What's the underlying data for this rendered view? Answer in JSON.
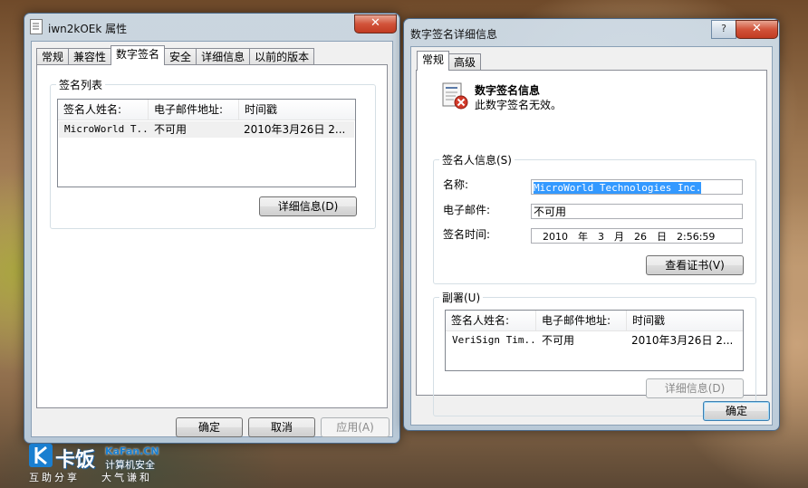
{
  "props_window": {
    "title": "iwn2kOEk 属性",
    "tabs": [
      "常规",
      "兼容性",
      "数字签名",
      "安全",
      "详细信息",
      "以前的版本"
    ],
    "active_tab": "数字签名",
    "group_label": "签名列表",
    "columns": [
      "签名人姓名:",
      "电子邮件地址:",
      "时间戳"
    ],
    "rows": [
      [
        "MicroWorld T...",
        "不可用",
        "2010年3月26日 2..."
      ]
    ],
    "details_button": "详细信息(D)",
    "ok_button": "确定",
    "cancel_button": "取消",
    "apply_button": "应用(A)"
  },
  "details_window": {
    "title": "数字签名详细信息",
    "help_label": "?",
    "close_label": "✕",
    "tabs": [
      "常规",
      "高级"
    ],
    "active_tab": "常规",
    "header_title": "数字签名信息",
    "header_status": "此数字签名无效。",
    "signer_group_label": "签名人信息(S)",
    "name_label": "名称:",
    "name_value": "MicroWorld Technologies Inc.",
    "email_label": "电子邮件:",
    "email_value": "不可用",
    "time_label": "签名时间:",
    "time_value": "2010　年　3　月　26　日　2:56:59",
    "view_cert_button": "查看证书(V)",
    "countersig_group_label": "副署(U)",
    "columns": [
      "签名人姓名:",
      "电子邮件地址:",
      "时间戳"
    ],
    "rows": [
      [
        "VeriSign Tim...",
        "不可用",
        "2010年3月26日 2..."
      ]
    ],
    "details_button": "详细信息(D)",
    "ok_button": "确定"
  },
  "watermark": {
    "brand": "卡饭",
    "site": "KaFan.CN",
    "slogan_right": "计算机安全",
    "slogan_left": "互助分享",
    "slogan_right2": "大气谦和"
  },
  "icons": {
    "props_title_icon": "document-icon",
    "signature_icon": "invalid-certificate-icon"
  },
  "colors": {
    "close_red": "#c13b22",
    "selection_blue": "#3399ff",
    "brand_blue": "#1a7fd0"
  }
}
